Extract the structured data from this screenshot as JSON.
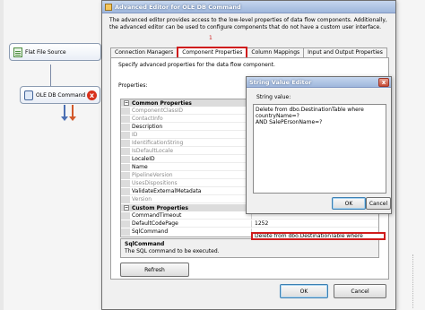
{
  "canvas": {
    "flat_file_source": "Flat File Source",
    "ole_db_command": "OLE DB Command",
    "error_icon": "x"
  },
  "dialog": {
    "title": "Advanced Editor for OLE DB Command",
    "intro": "The advanced editor provides access to the low-level properties of data flow components. Additionally, the advanced editor can be used to configure components that do not have a custom user interface.",
    "tabs": [
      "Connection Managers",
      "Component Properties",
      "Column Mappings",
      "Input and Output Properties"
    ],
    "active_tab": "Component Properties",
    "tab_marker": "1",
    "panel_description": "Specify advanced properties for the data flow component.",
    "properties_label": "Properties:",
    "categories": {
      "common": "Common Properties",
      "custom": "Custom Properties"
    },
    "common_properties": [
      {
        "name": "ComponentClassID",
        "value": "",
        "readonly": true
      },
      {
        "name": "ContactInfo",
        "value": "",
        "readonly": true
      },
      {
        "name": "Description",
        "value": "",
        "readonly": false
      },
      {
        "name": "ID",
        "value": "",
        "readonly": true
      },
      {
        "name": "IdentificationString",
        "value": "",
        "readonly": true
      },
      {
        "name": "IsDefaultLocale",
        "value": "",
        "readonly": true
      },
      {
        "name": "LocaleID",
        "value": "",
        "readonly": false
      },
      {
        "name": "Name",
        "value": "",
        "readonly": false
      },
      {
        "name": "PipelineVersion",
        "value": "",
        "readonly": true
      },
      {
        "name": "UsesDispositions",
        "value": "",
        "readonly": true
      },
      {
        "name": "ValidateExternalMetadata",
        "value": "",
        "readonly": false
      },
      {
        "name": "Version",
        "value": "",
        "readonly": true
      }
    ],
    "custom_properties": [
      {
        "name": "CommandTimeout",
        "value": ""
      },
      {
        "name": "DefaultCodePage",
        "value": "1252"
      },
      {
        "name": "SqlCommand",
        "value": "Delete from dbo.DestinationTable where"
      }
    ],
    "sql_marker": "2",
    "selected_property": {
      "name": "SqlCommand",
      "description": "The SQL command to be executed."
    },
    "buttons": {
      "refresh": "Refresh",
      "ok": "OK",
      "cancel": "Cancel"
    }
  },
  "string_editor": {
    "title": "String Value Editor",
    "label": "String value:",
    "value": "Delete from dbo.DestinationTable where countryName=?\nAND SalePErsonName=?",
    "buttons": {
      "ok": "OK",
      "cancel": "Cancel"
    },
    "close": "x"
  },
  "colors": {
    "highlight_red": "#cf1c1c",
    "flow_blue": "#4b6fb3",
    "flow_red": "#d2582b",
    "title_blue": "#9fb7dc"
  }
}
